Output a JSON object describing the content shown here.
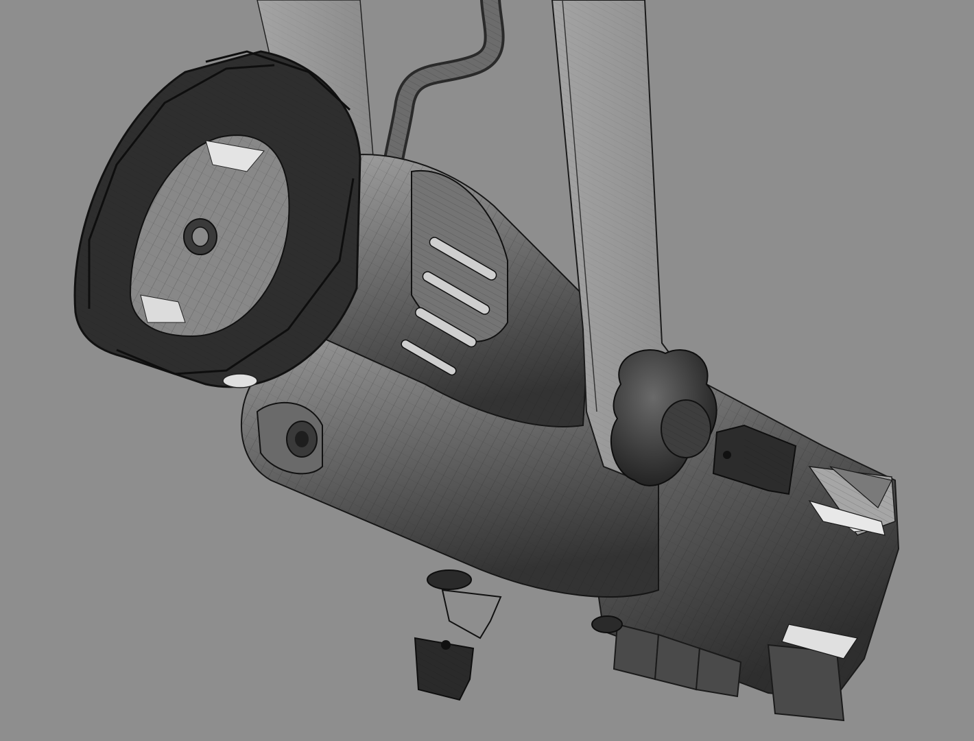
{
  "scene": {
    "background_color": "#8e8e8e",
    "subject_icon": "ellipsoidal-spotlight-wireframe-icon",
    "render_style": "shaded-wireframe",
    "colors": {
      "shell_dark": "#3a3a3a",
      "shell_mid": "#5e5e5e",
      "shell_light": "#8a8a8a",
      "highlight": "#d8d8d8",
      "bracket": "#9a9a9a",
      "wire": "#1a1a1a"
    }
  }
}
